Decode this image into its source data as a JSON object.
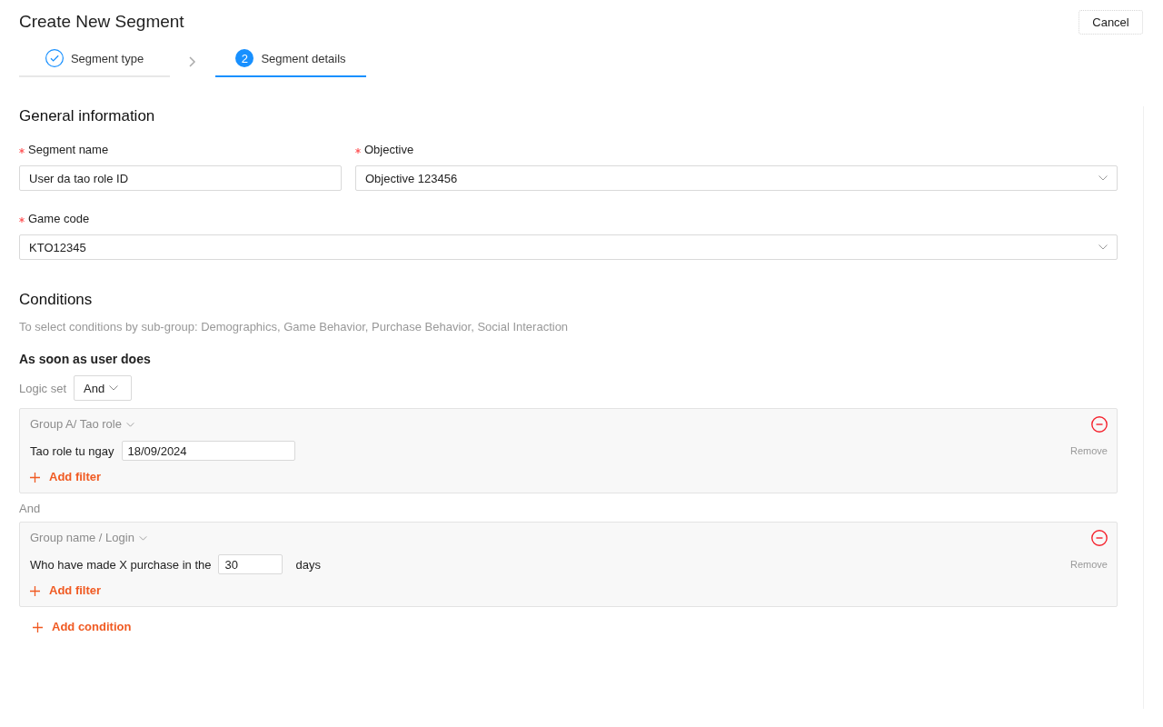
{
  "page": {
    "title": "Create New Segment",
    "cancel_button": "Cancel"
  },
  "steps": [
    {
      "label": "Segment type",
      "done": true,
      "selected": false
    },
    {
      "label": "Segment details",
      "number": "2",
      "done": false,
      "selected": true
    }
  ],
  "general_information": {
    "title": "General information",
    "fields": [
      {
        "label": "Segment name",
        "required": true,
        "kind": "input",
        "value": "User da tao role ID"
      },
      {
        "label": "Objective",
        "required": true,
        "kind": "select",
        "value": "Objective 123456"
      },
      {
        "label": "Game code",
        "required": true,
        "kind": "select",
        "value": "KTO12345"
      }
    ]
  },
  "conditions": {
    "title": "Conditions",
    "hint": "To select conditions by sub-group: Demographics, Game Behavior, Purchase Behavior, Social Interaction",
    "subtitle": "As soon as user does",
    "logic_set": {
      "label": "Logic set",
      "value": "And"
    },
    "groups": [
      {
        "name": "Group A/ Tao role",
        "remove": "Remove",
        "filters": [
          {
            "kind": "date",
            "label": "Tao role tu ngay",
            "value": "18/09/2024"
          }
        ],
        "add_filter": "Add filter"
      },
      {
        "connector": "And",
        "name": "Group name / Login",
        "remove": "Remove",
        "filters": [
          {
            "kind": "count",
            "label": "Who have made X purchase in the",
            "value": "30",
            "suffix": "days"
          }
        ],
        "add_filter": "Add filter"
      }
    ],
    "add_condition": "Add condition"
  }
}
